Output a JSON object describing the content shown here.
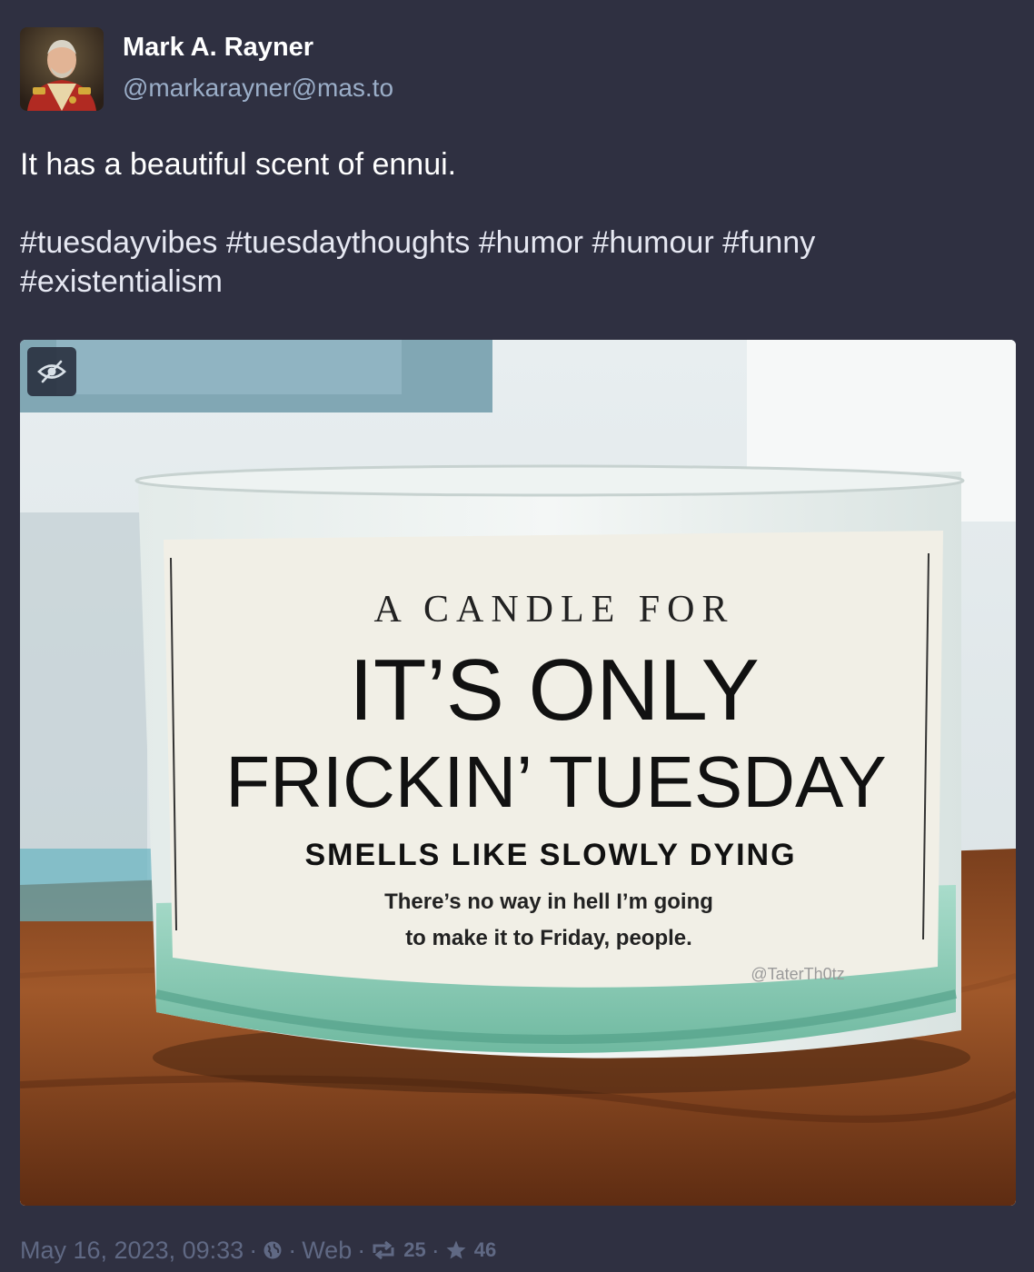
{
  "account": {
    "display_name": "Mark A. Rayner",
    "handle": "@markarayner@mas.to"
  },
  "status": {
    "text": "It has a beautiful scent of ennui.",
    "hashtags": [
      "#tuesdayvibes",
      "#tuesdaythoughts",
      "#humor",
      "#humour",
      "#funny",
      "#existentialism"
    ]
  },
  "media": {
    "image_text": {
      "line1": "A CANDLE FOR",
      "line2": "IT’S ONLY",
      "line3": "FRICKIN’ TUESDAY",
      "line4": "SMELLS LIKE SLOWLY DYING",
      "line5": "There’s no way in hell I’m going",
      "line6": "to make it to Friday, people.",
      "watermark": "@TaterTh0tz"
    },
    "hide_icon": "eye-slash-icon"
  },
  "meta": {
    "timestamp": "May 16, 2023, 09:33",
    "visibility_icon": "globe-icon",
    "application": "Web",
    "boosts": "25",
    "favourites": "46",
    "separator": "·"
  },
  "colors": {
    "background": "#2f3041",
    "text": "#ffffff",
    "secondary": "#9baec8",
    "meta": "#606984"
  }
}
